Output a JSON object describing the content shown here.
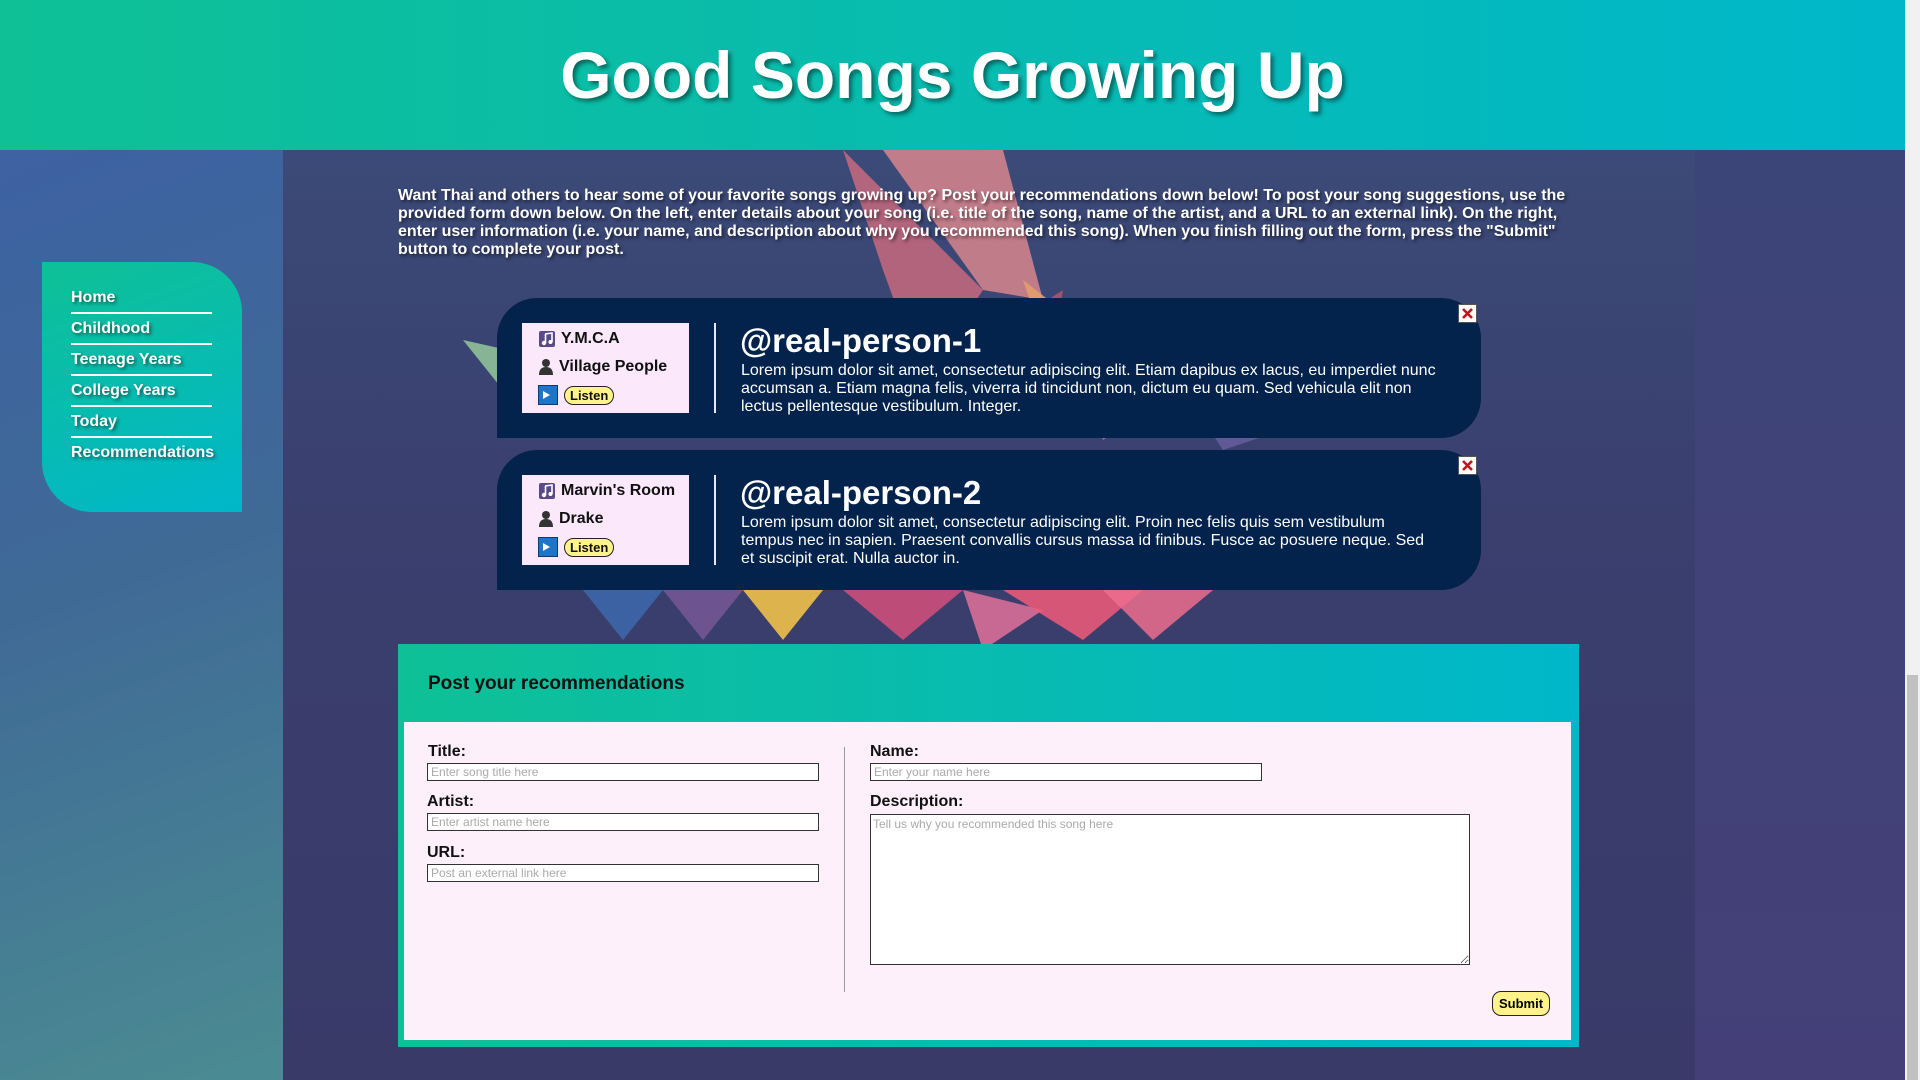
{
  "header": {
    "title": "Good Songs Growing Up"
  },
  "nav": {
    "items": [
      {
        "label": "Home"
      },
      {
        "label": "Childhood"
      },
      {
        "label": "Teenage Years"
      },
      {
        "label": "College Years"
      },
      {
        "label": "Today"
      },
      {
        "label": "Recommendations"
      }
    ]
  },
  "intro": {
    "text": "Want Thai and others to hear some of your favorite songs growing up? Post your recommendations down below! To post your song suggestions, use the provided form down below. On the left, enter details about your song (i.e. title of the song, name of the artist, and a URL to an external link). On the right, enter user information (i.e. your name, and description about why you recommended this song). When you finish filling out the form, press the \"Submit\" button to complete your post."
  },
  "posts": [
    {
      "song_title": "Y.M.C.A",
      "artist": "Village People",
      "listen_label": "Listen",
      "handle": "@real-person-1",
      "text": "Lorem ipsum dolor sit amet, consectetur adipiscing elit. Etiam dapibus ex lacus, eu imperdiet nunc accumsan a. Etiam magna felis, viverra id tincidunt non, dictum eu quam. Sed vehicula elit non lectus pellentesque vestibulum. Integer."
    },
    {
      "song_title": "Marvin's Room",
      "artist": "Drake",
      "listen_label": "Listen",
      "handle": "@real-person-2",
      "text": "Lorem ipsum dolor sit amet, consectetur adipiscing elit. Proin nec felis quis sem vestibulum tempus nec in sapien. Praesent convallis cursus massa id finibus. Fusce ac posuere neque. Sed et suscipit erat. Nulla auctor in."
    }
  ],
  "form": {
    "title": "Post your recommendations",
    "title_label": "Title:",
    "title_placeholder": "Enter song title here",
    "artist_label": "Artist:",
    "artist_placeholder": "Enter artist name here",
    "url_label": "URL:",
    "url_placeholder": "Post an external link here",
    "name_label": "Name:",
    "name_placeholder": "Enter your name here",
    "description_label": "Description:",
    "description_placeholder": "Tell us why you recommended this song here",
    "submit_label": "Submit"
  },
  "colors": {
    "header_gradient_start": "#0fc096",
    "header_gradient_end": "#00b7ca",
    "post_background": "#03224c",
    "button_yellow": "#fef38a",
    "card_pink": "#fbe8fb"
  },
  "icons": {
    "song": "music-note-icon",
    "artist": "person-icon",
    "listen": "play-icon",
    "close": "close-icon"
  }
}
